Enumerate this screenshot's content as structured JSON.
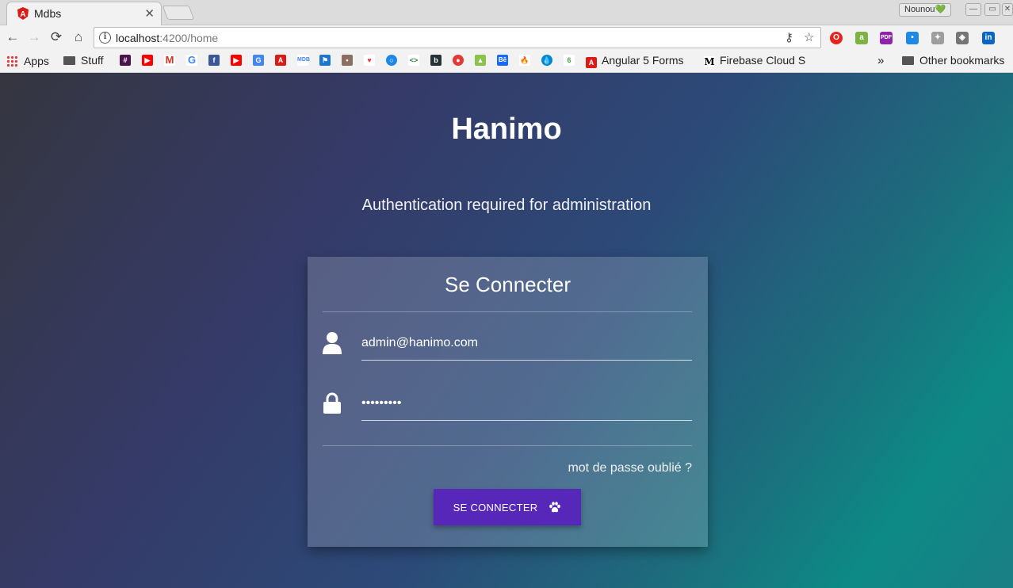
{
  "browser": {
    "tab_title": "Mdbs",
    "profile_name": "Nounou💚",
    "url_host": "localhost",
    "url_path": ":4200/home",
    "bookmarks": {
      "apps_label": "Apps",
      "stuff_label": "Stuff",
      "angular_label": "Angular 5 Forms",
      "firebase_label": "Firebase Cloud S",
      "overflow_label": "»",
      "other_label": "Other bookmarks"
    }
  },
  "page": {
    "brand": "Hanimo",
    "subtitle": "Authentication required for administration",
    "card": {
      "title": "Se Connecter",
      "email_value": "admin@hanimo.com",
      "password_value": "•••••••••",
      "forgot_link": "mot de passe oublié ?",
      "submit_label": "SE CONNECTER"
    }
  },
  "colors": {
    "button": "#5627b8",
    "gradient_start": "#35363f",
    "gradient_end": "#0d8a86"
  }
}
